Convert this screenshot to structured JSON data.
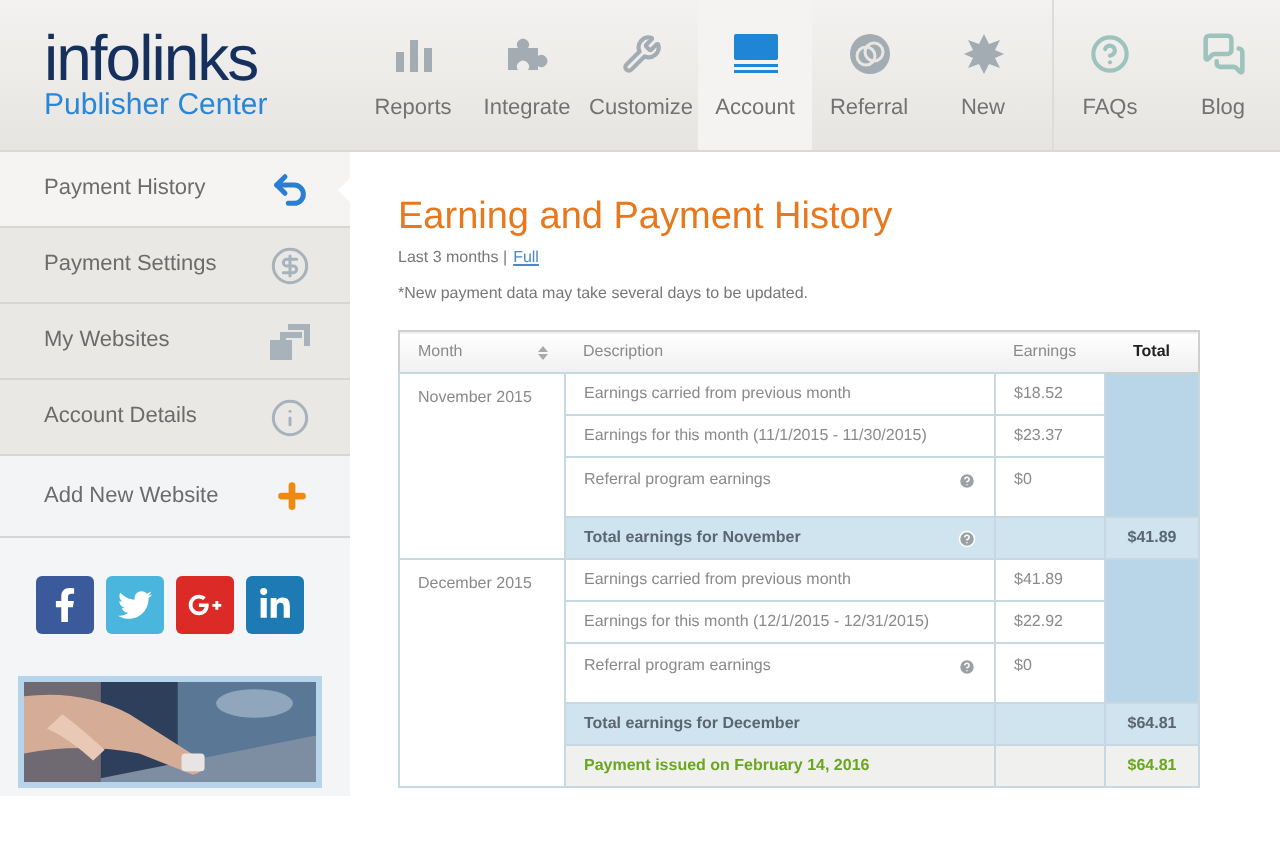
{
  "logo": {
    "name": "infolinks",
    "subtitle": "Publisher Center"
  },
  "nav": [
    {
      "label": "Reports",
      "selected": false
    },
    {
      "label": "Integrate",
      "selected": false
    },
    {
      "label": "Customize",
      "selected": false
    },
    {
      "label": "Account",
      "selected": true
    },
    {
      "label": "Referral",
      "selected": false
    },
    {
      "label": "New",
      "selected": false
    },
    {
      "label": "FAQs",
      "selected": false
    },
    {
      "label": "Blog",
      "selected": false
    }
  ],
  "sidebar": {
    "items": [
      {
        "label": "Payment History",
        "selected": true
      },
      {
        "label": "Payment Settings",
        "selected": false
      },
      {
        "label": "My Websites",
        "selected": false
      },
      {
        "label": "Account Details",
        "selected": false
      },
      {
        "label": "Add New Website",
        "selected": false
      }
    ]
  },
  "page": {
    "title": "Earning and Payment History",
    "range": "Last 3 months |",
    "range_link": "Full",
    "note": "*New payment data may take several days to be updated."
  },
  "table": {
    "columns": [
      "Month",
      "Description",
      "Earnings",
      "Total"
    ],
    "months": [
      {
        "month": "November 2015",
        "rows": [
          {
            "kind": "item",
            "description": "Earnings carried from previous month",
            "earnings": "$18.52"
          },
          {
            "kind": "item",
            "description": "Earnings for this month (11/1/2015 - 11/30/2015)",
            "earnings": "$23.37"
          },
          {
            "kind": "item",
            "description": "Referral program earnings",
            "earnings": "$0",
            "help": true
          },
          {
            "kind": "total",
            "description": "Total earnings for November",
            "total": "$41.89",
            "help": true
          }
        ]
      },
      {
        "month": "December 2015",
        "rows": [
          {
            "kind": "item",
            "description": "Earnings carried from previous month",
            "earnings": "$41.89"
          },
          {
            "kind": "item",
            "description": "Earnings for this month (12/1/2015 - 12/31/2015)",
            "earnings": "$22.92"
          },
          {
            "kind": "item",
            "description": "Referral program earnings",
            "earnings": "$0",
            "help": true
          },
          {
            "kind": "total",
            "description": "Total earnings for December",
            "total": "$64.81"
          },
          {
            "kind": "payment",
            "description": "Payment issued on February 14, 2016",
            "total": "$64.81"
          }
        ]
      }
    ]
  }
}
